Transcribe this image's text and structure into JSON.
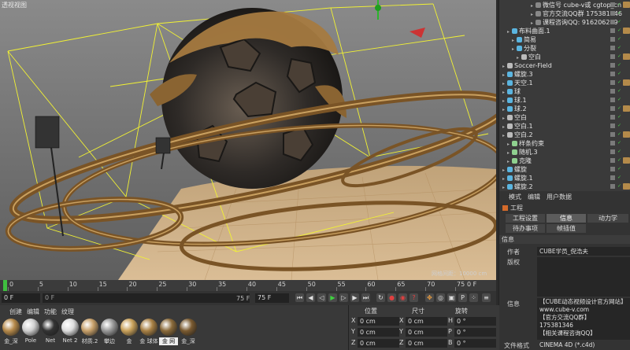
{
  "viewport": {
    "title": "透视视图",
    "scale_label": "网格间距：10000 cm"
  },
  "object_manager": {
    "rows": [
      {
        "label": "微信号 cube-v或 cgtop_cn",
        "indent": 6,
        "color": "#888"
      },
      {
        "label": "官方交流QQ群 175381346",
        "indent": 6,
        "color": "#888"
      },
      {
        "label": "课程咨询QQ: 916206209",
        "indent": 6,
        "color": "#888"
      },
      {
        "label": "布料曲面.1",
        "indent": 1,
        "color": "#5bb5e0"
      },
      {
        "label": "简易",
        "indent": 2,
        "color": "#5bb5e0"
      },
      {
        "label": "分裂",
        "indent": 2,
        "color": "#5bb5e0"
      },
      {
        "label": "空白",
        "indent": 3,
        "color": "#bbbbbb"
      },
      {
        "label": "Soccer-Field",
        "indent": 0,
        "color": "#bbbbbb"
      },
      {
        "label": "螺旋.3",
        "indent": 0,
        "color": "#5bb5e0"
      },
      {
        "label": "天空.1",
        "indent": 0,
        "color": "#5bb5e0"
      },
      {
        "label": "球",
        "indent": 0,
        "color": "#5bb5e0"
      },
      {
        "label": "球.1",
        "indent": 0,
        "color": "#5bb5e0"
      },
      {
        "label": "球.2",
        "indent": 0,
        "color": "#5bb5e0"
      },
      {
        "label": "空白",
        "indent": 0,
        "color": "#bbbbbb"
      },
      {
        "label": "空白.1",
        "indent": 0,
        "color": "#bbbbbb"
      },
      {
        "label": "空白.2",
        "indent": 0,
        "color": "#bbbbbb"
      },
      {
        "label": "样条约束",
        "indent": 1,
        "color": "#8fd18f"
      },
      {
        "label": "随机.3",
        "indent": 1,
        "color": "#8fd18f"
      },
      {
        "label": "克隆",
        "indent": 1,
        "color": "#8fd18f"
      },
      {
        "label": "螺旋",
        "indent": 0,
        "color": "#5bb5e0"
      },
      {
        "label": "螺旋.1",
        "indent": 0,
        "color": "#5bb5e0"
      },
      {
        "label": "螺旋.2",
        "indent": 0,
        "color": "#5bb5e0"
      }
    ]
  },
  "attributes": {
    "menu": [
      "模式",
      "编辑",
      "用户数据"
    ],
    "mode_label": "工程",
    "tabs_row1": [
      "工程设置",
      "信息",
      "动力学"
    ],
    "tabs_row2": [
      "待办事项",
      "帧插值"
    ],
    "section_title": "信息",
    "author_label": "作者",
    "author_value": "CUBE学员_倪浩夫",
    "copyright_label": "版权",
    "info_label": "信息",
    "info_lines": [
      "【CUBE动态视频设计官方网站】",
      "www.cube-v.com",
      "【官方交流QQ群】",
      "175381346",
      "【相关课程咨询QQ】"
    ],
    "format_label": "文件格式",
    "format_value": "CINEMA 4D (*.c4d)"
  },
  "timeline": {
    "ticks": [
      "0",
      "5",
      "10",
      "15",
      "20",
      "25",
      "30",
      "35",
      "40",
      "45",
      "50",
      "55",
      "60",
      "65",
      "70",
      "75"
    ],
    "current_frame": "0 F"
  },
  "transport": {
    "start_field": "0 F",
    "current_field": "0 F",
    "range_end": "75 F",
    "end_field": "75 F"
  },
  "materials": {
    "menu": [
      "创建",
      "编辑",
      "功能",
      "纹理"
    ],
    "items": [
      {
        "label": "金_深",
        "color": "#b5894a"
      },
      {
        "label": "Pole",
        "color": "#cfcfcf"
      },
      {
        "label": "Net",
        "color": "#333333"
      },
      {
        "label": "Net 2",
        "color": "#dddddd"
      },
      {
        "label": "材质.2",
        "color": "#c7a06a"
      },
      {
        "label": "攀边",
        "color": "#999999"
      },
      {
        "label": "金",
        "color": "#c9a15a"
      },
      {
        "label": "金 球体",
        "color": "#a88044"
      },
      {
        "label": "金 网",
        "color": "#8a6a3a"
      },
      {
        "label": "金_深",
        "color": "#7a5a30"
      }
    ]
  },
  "coordinates": {
    "headers": [
      "位置",
      "尺寸",
      "旋转"
    ],
    "rows": [
      {
        "axis": "X",
        "pos": "0 cm",
        "size": "0 cm",
        "rot_axis": "H",
        "rot": "0 °"
      },
      {
        "axis": "Y",
        "pos": "0 cm",
        "size": "0 cm",
        "rot_axis": "P",
        "rot": "0 °"
      },
      {
        "axis": "Z",
        "pos": "0 cm",
        "size": "0 cm",
        "rot_axis": "B",
        "rot": "0 °"
      }
    ]
  }
}
